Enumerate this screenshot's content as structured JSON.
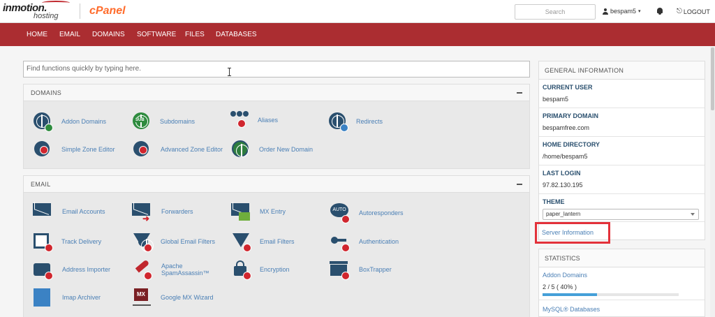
{
  "header": {
    "brand_line1": "inmotion.",
    "brand_line2": "hosting",
    "cpanel": "cPanel",
    "search_placeholder": "Search",
    "user": "bespam5",
    "logout": "LOGOUT"
  },
  "nav": [
    "HOME",
    "EMAIL",
    "DOMAINS",
    "SOFTWARE",
    "FILES",
    "DATABASES"
  ],
  "quick_find_placeholder": "Find functions quickly by typing here.",
  "domains": {
    "title": "DOMAINS",
    "items": [
      "Addon Domains",
      "Subdomains",
      "Aliases",
      "Redirects",
      "Simple Zone Editor",
      "Advanced Zone Editor",
      "Order New Domain"
    ]
  },
  "email": {
    "title": "EMAIL",
    "items": [
      "Email Accounts",
      "Forwarders",
      "MX Entry",
      "Autoresponders",
      "Track Delivery",
      "Global Email Filters",
      "Email Filters",
      "Authentication",
      "Address Importer",
      "Apache SpamAssassin™",
      "Encryption",
      "BoxTrapper",
      "Imap Archiver",
      "Google MX Wizard"
    ]
  },
  "general_info": {
    "title": "GENERAL INFORMATION",
    "current_user_label": "CURRENT USER",
    "current_user": "bespam5",
    "primary_domain_label": "PRIMARY DOMAIN",
    "primary_domain": "bespamfree.com",
    "home_directory_label": "HOME DIRECTORY",
    "home_directory": "/home/bespam5",
    "last_login_label": "LAST LOGIN",
    "last_login": "97.82.130.195",
    "theme_label": "THEME",
    "theme": "paper_lantern",
    "server_info": "Server Information"
  },
  "statistics": {
    "title": "STATISTICS",
    "addon_domains_label": "Addon Domains",
    "addon_domains_value": "2 / 5 ( 40% )",
    "addon_domains_progress": 0.4,
    "mysql_label": "MySQL® Databases"
  },
  "icon_labels": {
    "sub": "SUB",
    "auto": "AUTO",
    "mx": "MX"
  },
  "colors": {
    "nav_bg": "#ab2d31",
    "link": "#4a7fb5",
    "cpanel_orange": "#ff6c2c",
    "highlight": "#e3313a"
  }
}
